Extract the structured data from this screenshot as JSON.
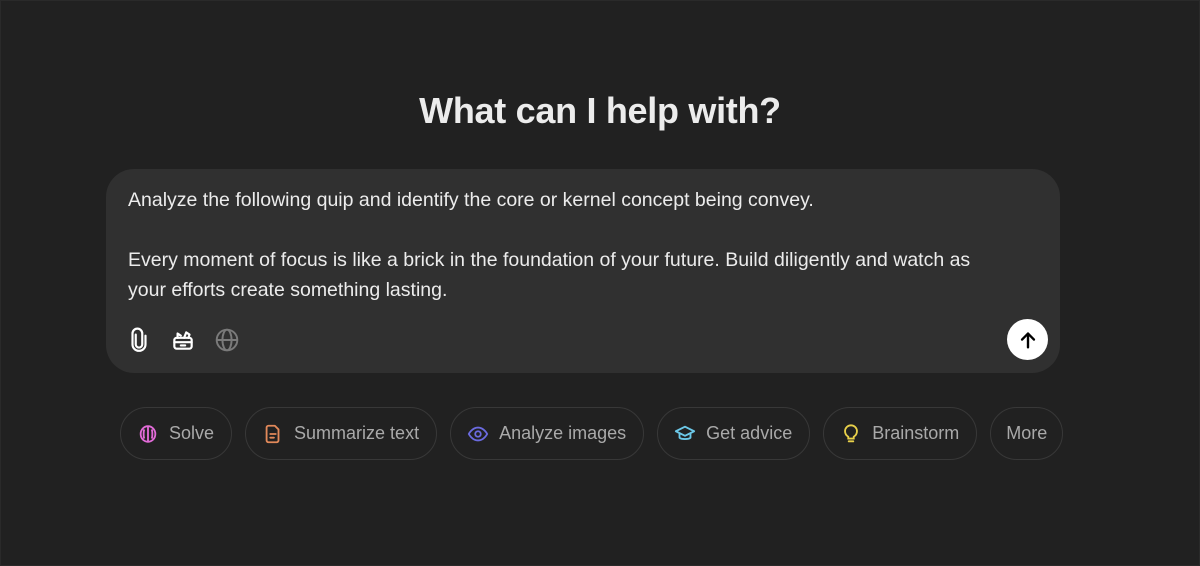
{
  "heading": "What can I help with?",
  "composer": {
    "prompt_text": "Analyze the following quip and identify the core or kernel concept being convey.\n\nEvery moment of focus is like a brick in the foundation of your future. Build diligently and watch as\nyour efforts create something lasting.",
    "tools": [
      {
        "name": "attach",
        "icon": "paperclip-icon"
      },
      {
        "name": "tools",
        "icon": "toolbox-icon"
      },
      {
        "name": "search-web",
        "icon": "globe-icon"
      }
    ],
    "send_icon": "arrow-up-icon"
  },
  "suggestions": [
    {
      "label": "Solve",
      "icon": "brain-icon",
      "color": "#e26bd8"
    },
    {
      "label": "Summarize text",
      "icon": "document-icon",
      "color": "#e2895a"
    },
    {
      "label": "Analyze images",
      "icon": "eye-icon",
      "color": "#6b6be0"
    },
    {
      "label": "Get advice",
      "icon": "graduation-cap-icon",
      "color": "#6cc8e8"
    },
    {
      "label": "Brainstorm",
      "icon": "lightbulb-icon",
      "color": "#e8d04a"
    },
    {
      "label": "More",
      "icon": "",
      "color": ""
    }
  ],
  "colors": {
    "background": "#212121",
    "composer": "#303030",
    "send_button": "#ffffff"
  }
}
